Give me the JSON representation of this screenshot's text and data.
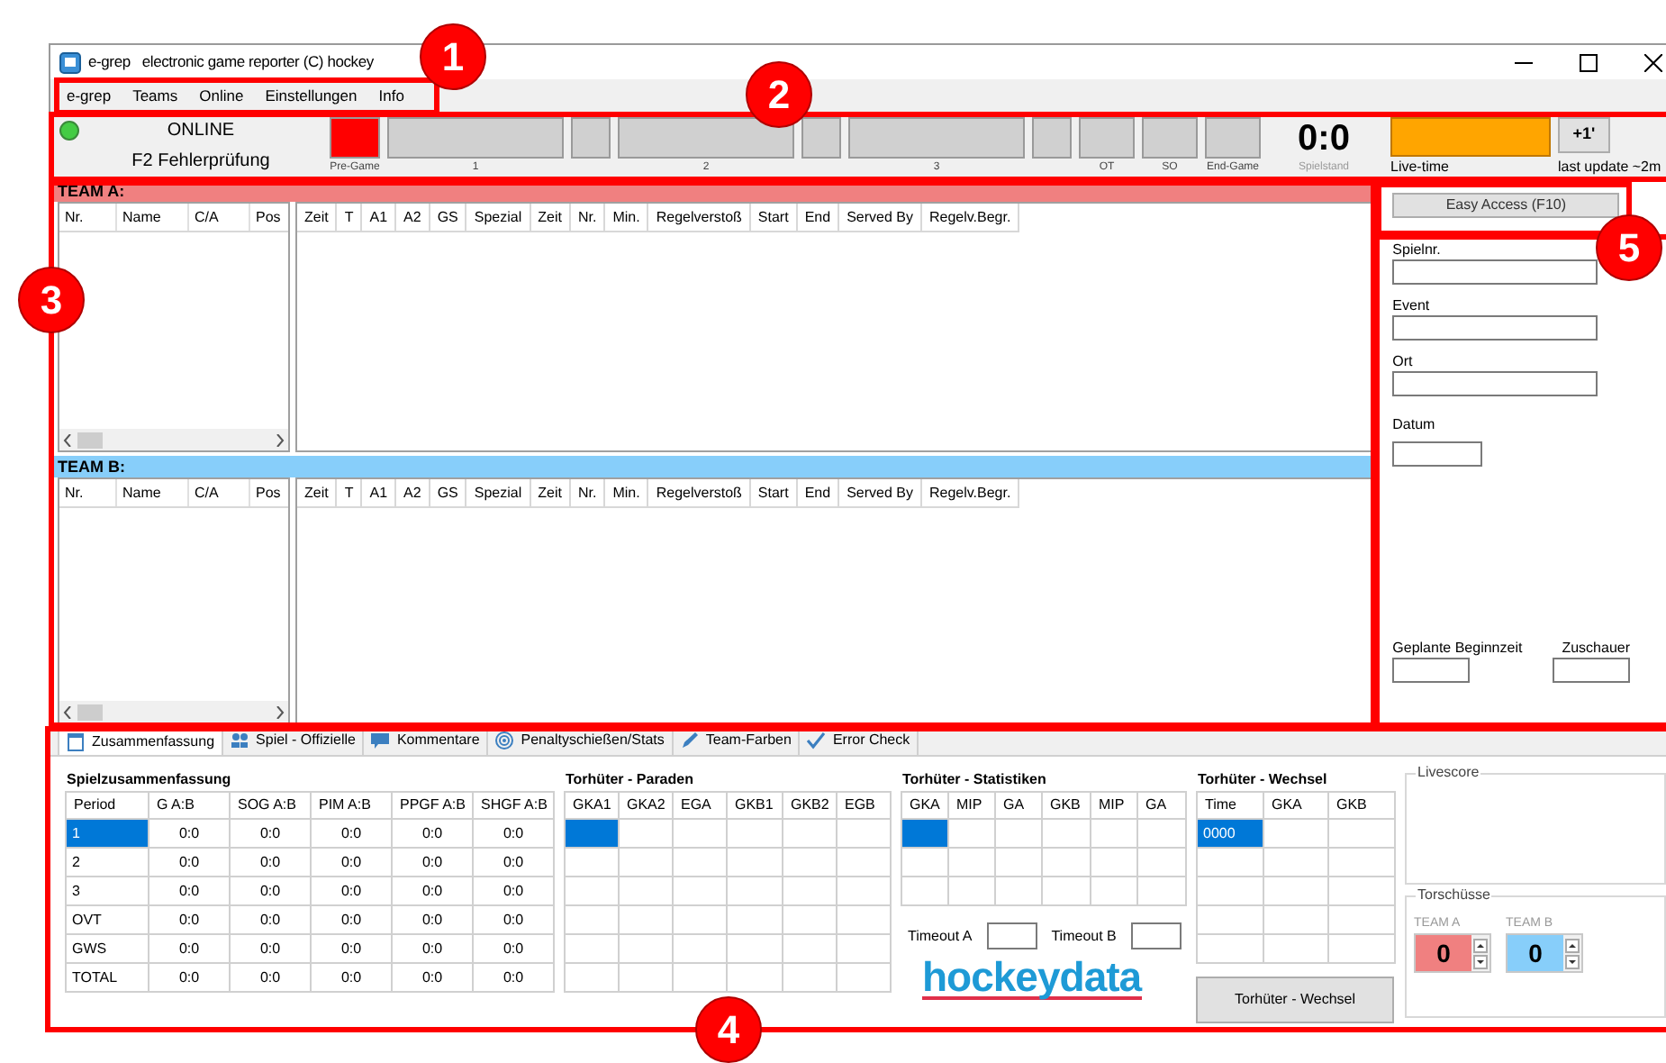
{
  "window": {
    "title": "e-grep   electronic game reporter (C) hockey"
  },
  "menu": [
    "e-grep",
    "Teams",
    "Online",
    "Einstellungen",
    "Info"
  ],
  "status": {
    "online": true,
    "label": "ONLINE",
    "mode": "F2 Fehlerprüfung"
  },
  "stages": [
    {
      "kind": "pregame",
      "label": "Pre-Game",
      "selected": true
    },
    {
      "kind": "period",
      "label": "1",
      "selected": false
    },
    {
      "kind": "break",
      "selected": false
    },
    {
      "kind": "period",
      "label": "2",
      "selected": false
    },
    {
      "kind": "break",
      "selected": false
    },
    {
      "kind": "period",
      "label": "3",
      "selected": false
    },
    {
      "kind": "break",
      "selected": false
    },
    {
      "kind": "extra",
      "label": "OT",
      "selected": false
    },
    {
      "kind": "extra",
      "label": "SO",
      "selected": false
    },
    {
      "kind": "extra",
      "label": "End-Game",
      "selected": false
    }
  ],
  "score": {
    "value": "0:0",
    "label": "Spielstand"
  },
  "live_time": {
    "label": "Live-time"
  },
  "plus_button": "+1'",
  "last_update": "last update ~2m",
  "teams": [
    {
      "title": "TEAM A:",
      "color": "#f08080",
      "roster_columns": [
        "Nr.",
        "Name",
        "C/A",
        "Pos"
      ],
      "penalty_columns": [
        "Zeit",
        "T",
        "A1",
        "A2",
        "GS",
        "Spezial",
        "Zeit",
        "Nr.",
        "Min.",
        "Regelverstoß",
        "Start",
        "End",
        "Served By",
        "Regelv.Begr."
      ]
    },
    {
      "title": "TEAM B:",
      "color": "#87cefa",
      "roster_columns": [
        "Nr.",
        "Name",
        "C/A",
        "Pos"
      ],
      "penalty_columns": [
        "Zeit",
        "T",
        "A1",
        "A2",
        "GS",
        "Spezial",
        "Zeit",
        "Nr.",
        "Min.",
        "Regelverstoß",
        "Start",
        "End",
        "Served By",
        "Regelv.Begr."
      ]
    }
  ],
  "side_panel": {
    "button": "Easy Access (F10)",
    "fields": [
      {
        "label": "Spielnr.",
        "kind": "wide"
      },
      {
        "label": "Event",
        "kind": "wide"
      },
      {
        "label": "Ort",
        "kind": "wide"
      },
      {
        "label": "Datum",
        "kind": "short"
      }
    ],
    "bottom_fields": [
      {
        "label": "Geplante Beginnzeit"
      },
      {
        "label": "Zuschauer"
      }
    ]
  },
  "bottom_tabs": [
    {
      "label": "Zusammenfassung",
      "selected": true
    },
    {
      "label": "Spiel - Offizielle",
      "selected": false
    },
    {
      "label": "Kommentare",
      "selected": false
    },
    {
      "label": "Penaltyschießen/Stats",
      "selected": false
    },
    {
      "label": "Team-Farben",
      "selected": false
    },
    {
      "label": "Error Check",
      "selected": false
    }
  ],
  "summary": {
    "title": "Spielzusammenfassung",
    "columns": [
      "Period",
      "G A:B",
      "SOG A:B",
      "PIM A:B",
      "PPGF A:B",
      "SHGF A:B"
    ],
    "rows": [
      {
        "cells": [
          "1",
          "0:0",
          "0:0",
          "0:0",
          "0:0",
          "0:0"
        ],
        "selected": true
      },
      {
        "cells": [
          "2",
          "0:0",
          "0:0",
          "0:0",
          "0:0",
          "0:0"
        ],
        "selected": false
      },
      {
        "cells": [
          "3",
          "0:0",
          "0:0",
          "0:0",
          "0:0",
          "0:0"
        ],
        "selected": false
      },
      {
        "cells": [
          "OVT",
          "0:0",
          "0:0",
          "0:0",
          "0:0",
          "0:0"
        ],
        "selected": false
      },
      {
        "cells": [
          "GWS",
          "0:0",
          "0:0",
          "0:0",
          "0:0",
          "0:0"
        ],
        "selected": false
      },
      {
        "cells": [
          "TOTAL",
          "0:0",
          "0:0",
          "0:0",
          "0:0",
          "0:0"
        ],
        "selected": false
      }
    ]
  },
  "saves": {
    "title": "Torhüter - Paraden",
    "columns": [
      "GKA1",
      "GKA2",
      "EGA",
      "GKB1",
      "GKB2",
      "EGB"
    ],
    "rows": [
      {
        "selected": true
      },
      {
        "selected": false
      },
      {
        "selected": false
      },
      {
        "selected": false
      },
      {
        "selected": false
      },
      {
        "selected": false
      }
    ]
  },
  "goalie_stats": {
    "title": "Torhüter - Statistiken",
    "columns": [
      "GKA",
      "MIP",
      "GA",
      "GKB",
      "MIP",
      "GA"
    ],
    "rows": [
      {
        "selected": true
      },
      {
        "selected": false
      },
      {
        "selected": false
      }
    ],
    "timeouts": [
      "Timeout A",
      "Timeout B"
    ],
    "logo": "hockeydata"
  },
  "goalie_changes": {
    "title": "Torhüter - Wechsel",
    "columns": [
      "Time",
      "GKA",
      "GKB"
    ],
    "rows": [
      {
        "cells": [
          "0000"
        ],
        "selected": true
      },
      {
        "selected": false
      },
      {
        "selected": false
      },
      {
        "selected": false
      },
      {
        "selected": false
      }
    ],
    "button": "Torhüter - Wechsel"
  },
  "livescore": {
    "title": "Livescore"
  },
  "shots": {
    "title": "Torschüsse",
    "teams": [
      {
        "label": "TEAM A",
        "value": "0",
        "color": "#f08080"
      },
      {
        "label": "TEAM B",
        "value": "0",
        "color": "#87cefa"
      }
    ]
  },
  "callouts": [
    {
      "number": "1"
    },
    {
      "number": "2"
    },
    {
      "number": "3"
    },
    {
      "number": "4"
    },
    {
      "number": "5"
    }
  ]
}
